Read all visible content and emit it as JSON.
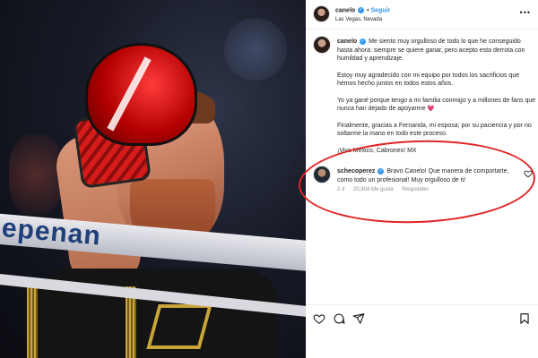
{
  "photo": {
    "alt_subject": "boxer",
    "ring_banner_text": "epenan"
  },
  "post": {
    "header": {
      "username": "canelo",
      "separator": "•",
      "follow_label": "Seguir",
      "location": "Las Vegas, Nevada",
      "more_icon": "more-horizontal-icon"
    },
    "caption": {
      "username": "canelo",
      "paragraphs": [
        "Me siento muy orgulloso de todo lo que he conseguido hasta ahora: siempre se quiere ganar, pero acepto esta derrota con humildad y aprendizaje.",
        "Estoy muy agradecido con mi equipo por todos los sacrificios que hemos hecho juntos en todos estos años.",
        "Yo ya gané porque tengo a mi familia conmigo y a millones de fans que nunca han dejado de apoyarme",
        "Finalmente, gracias a Fernanda, mi esposa; por su paciencia y por no soltarme la mano en todo este proceso.",
        "¡Viva México, Cabrones! MX"
      ],
      "heart_emoji": "💗"
    },
    "comment": {
      "username": "schecoperez",
      "text": "Bravo Canelo! Que manera de comportarte, como todo un profesional! Muy orgulloso de ti!",
      "time": "2 d",
      "likes": "20,804 Me gusta",
      "reply_label": "Responder"
    },
    "actions": {
      "like_icon": "heart-icon",
      "comment_icon": "comment-icon",
      "share_icon": "send-icon",
      "save_icon": "bookmark-icon"
    }
  },
  "colors": {
    "accent_blue": "#3897f0",
    "highlight_red": "#e02424",
    "heart_red": "#e0245e"
  }
}
